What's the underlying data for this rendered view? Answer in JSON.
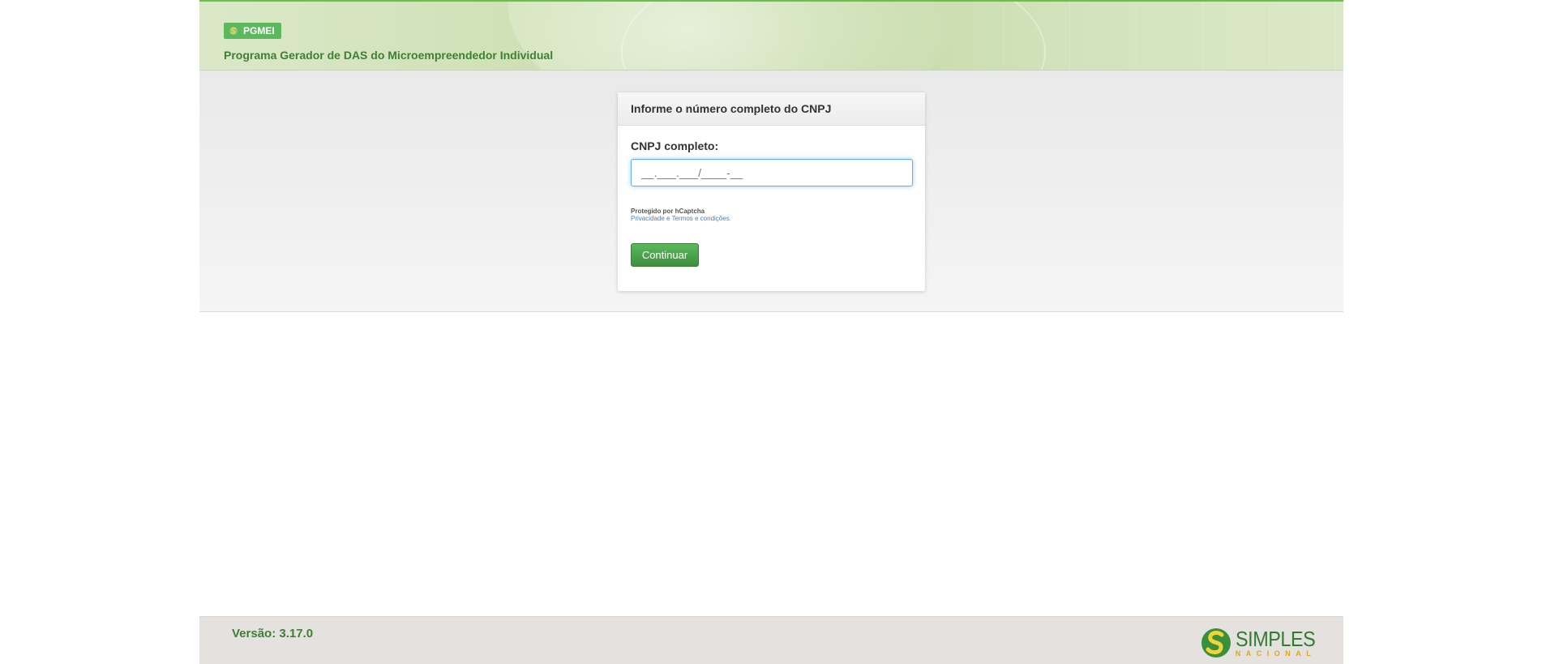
{
  "header": {
    "badge_label": "PGMEI",
    "subtitle": "Programa Gerador de DAS do Microempreendedor Individual"
  },
  "form": {
    "card_title": "Informe o número completo do CNPJ",
    "cnpj_label": "CNPJ completo:",
    "cnpj_value": "__.___.___/____-__",
    "captcha_protected": "Protegido por hCaptcha",
    "captcha_privacy": "Privacidade",
    "captcha_sep": " e ",
    "captcha_terms": "Termos e condições",
    "captcha_dot": ".",
    "continue_label": "Continuar"
  },
  "footer": {
    "version": "Versão: 3.17.0",
    "logo_main": "SIMPLES",
    "logo_sub": "NACIONAL"
  },
  "colors": {
    "brand_green": "#3f7f34",
    "button_green": "#5cb85c",
    "logo_yellow": "#d8a820",
    "focus_blue": "#66afe9"
  },
  "icons": [
    "simples-nacional-logo-icon"
  ]
}
